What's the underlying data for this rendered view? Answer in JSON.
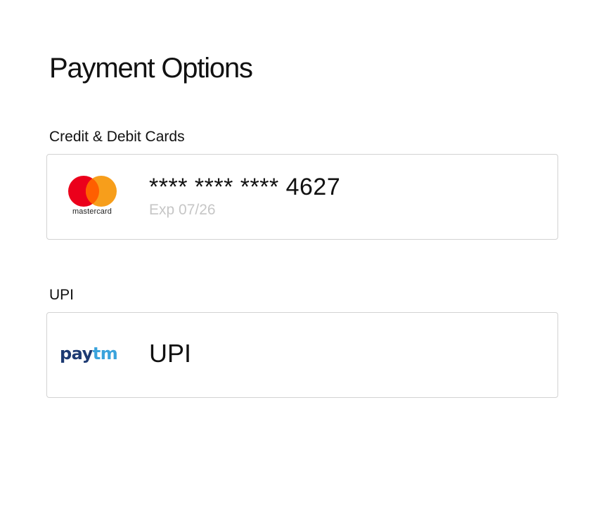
{
  "page": {
    "title": "Payment Options"
  },
  "sections": {
    "cards": {
      "label": "Credit & Debit Cards",
      "card": {
        "number": "**** **** **** 4627",
        "expiry": "Exp 07/26",
        "brand": "mastercard",
        "brand_icon": "mastercard-logo",
        "brand_colors": [
          "#eb001b",
          "#f79e1b",
          "#ff5f00"
        ]
      }
    },
    "upi": {
      "label": "UPI",
      "option": {
        "title": "UPI",
        "provider_pay": "pay",
        "provider_tm": "tm",
        "provider_icon": "paytm-logo",
        "provider_colors": [
          "#1d3a72",
          "#3aa3dc"
        ]
      }
    }
  }
}
